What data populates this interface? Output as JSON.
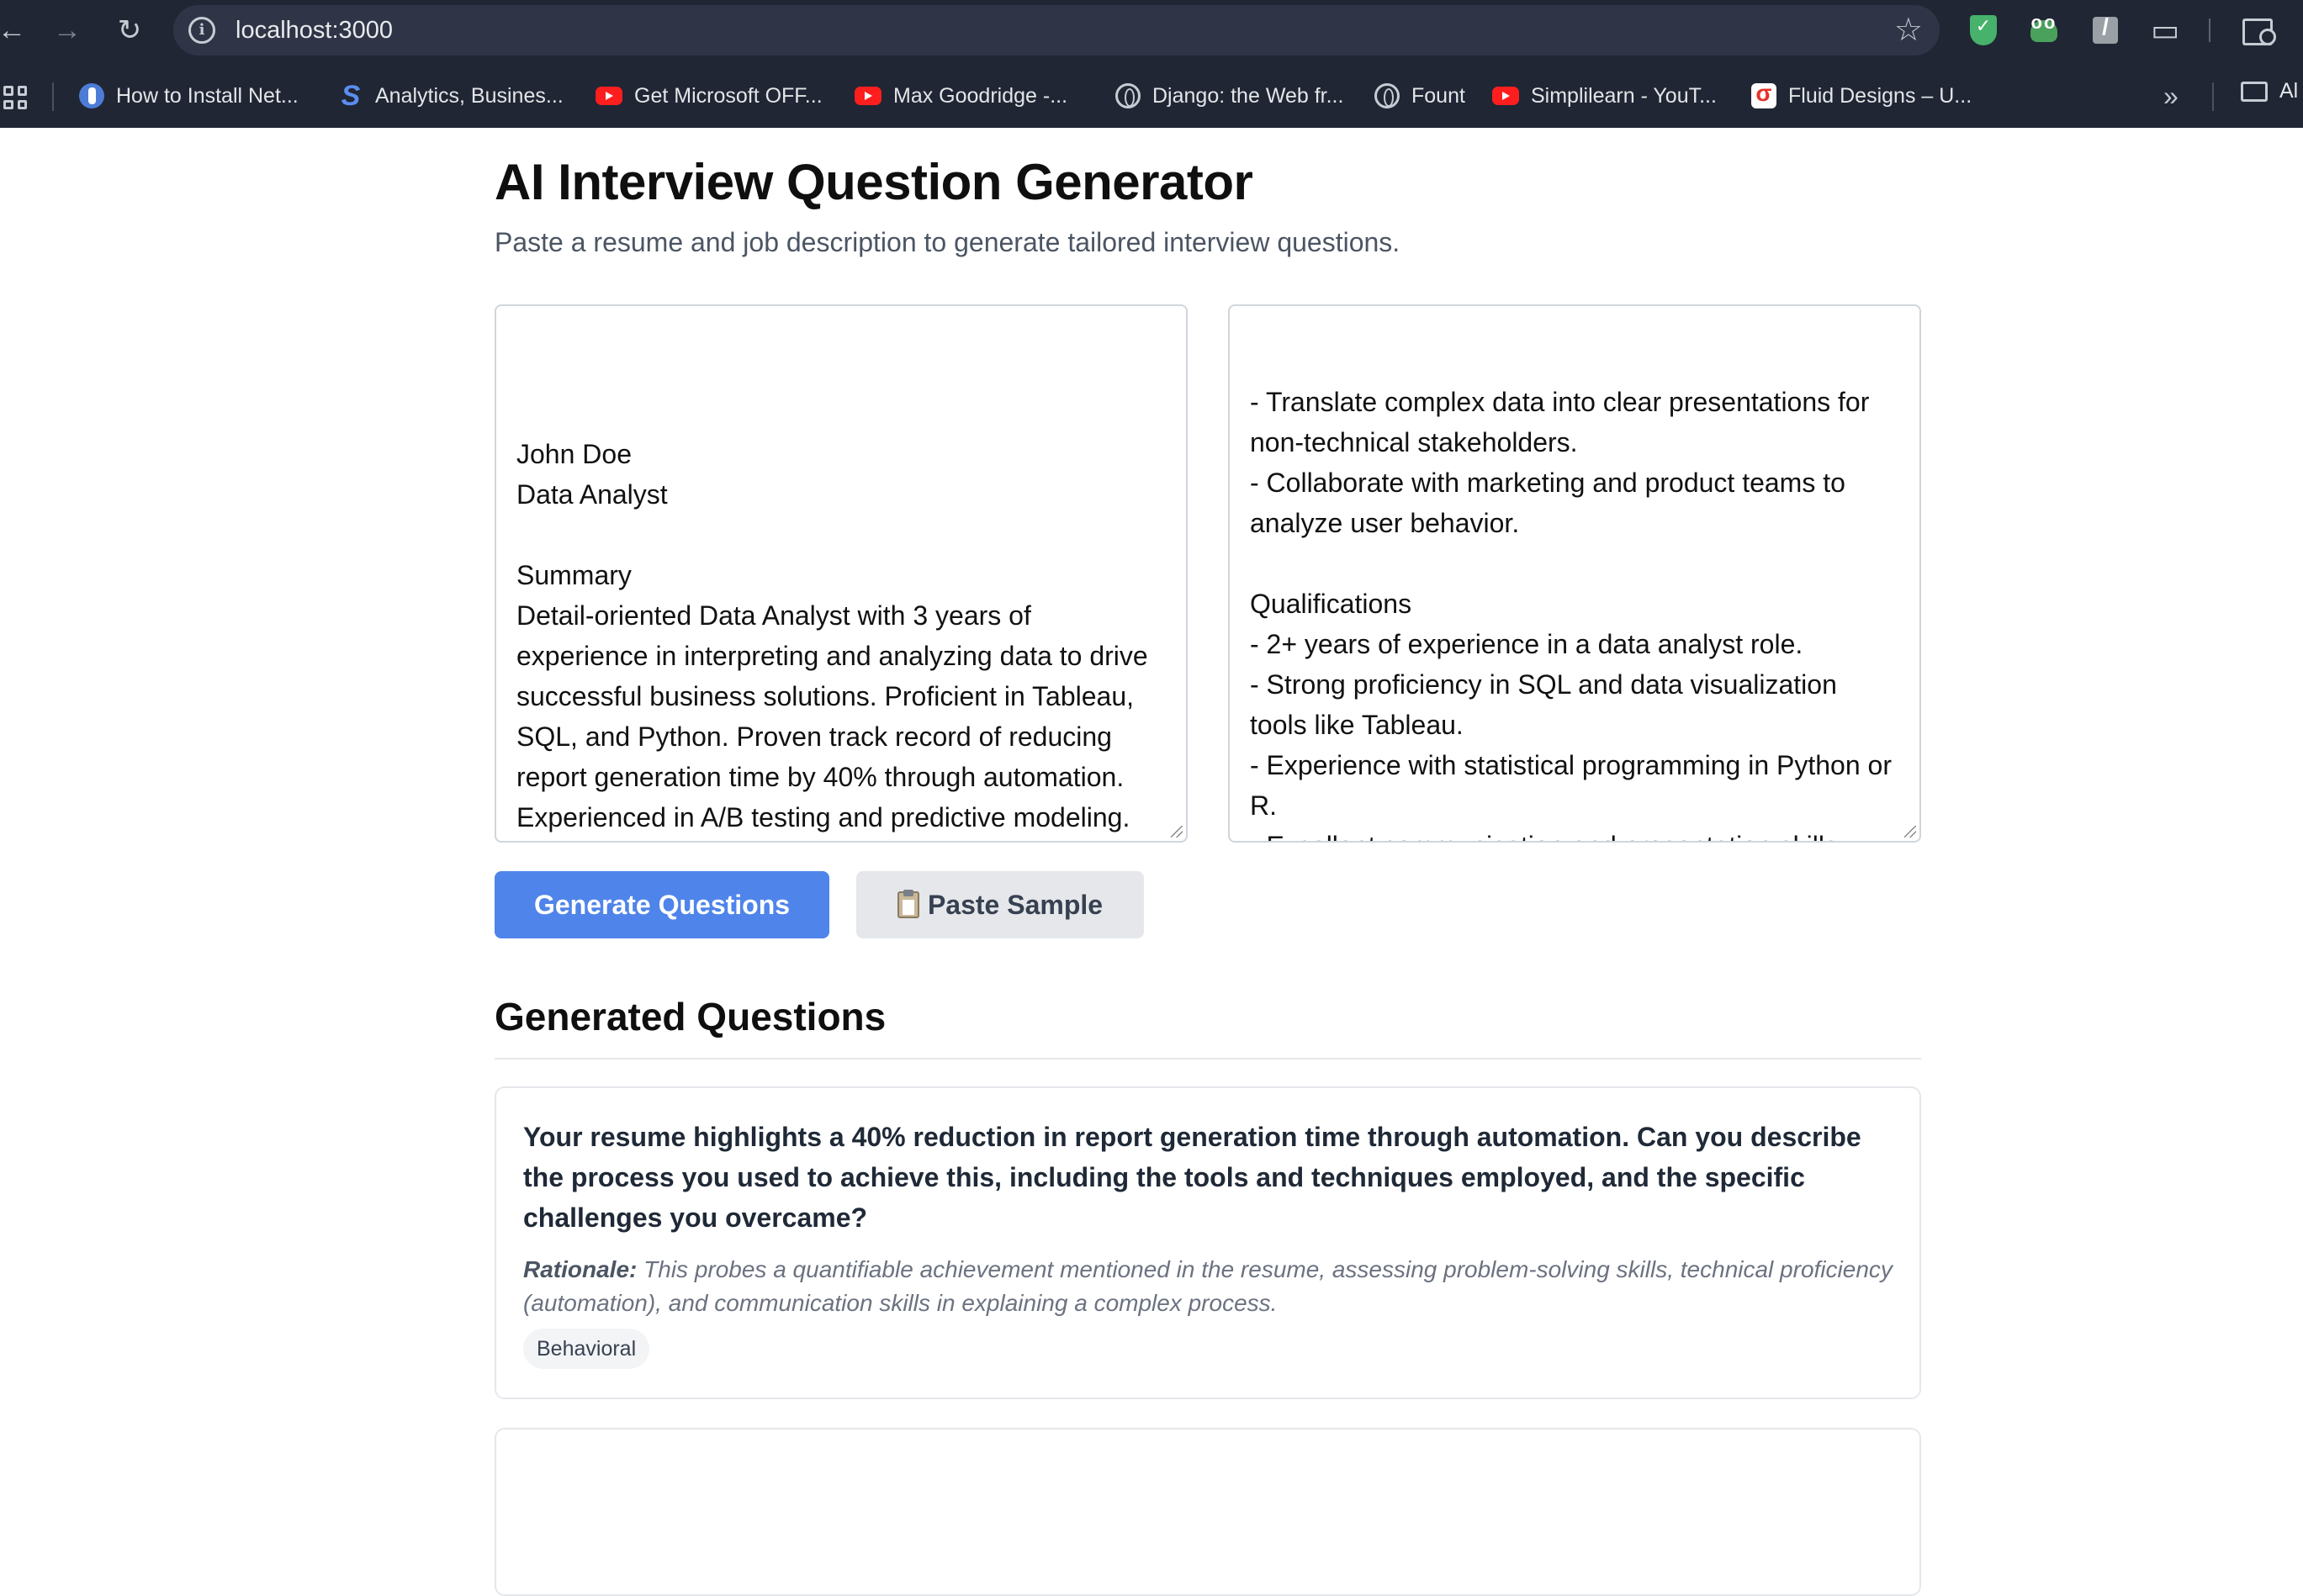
{
  "browser": {
    "url": "localhost:3000",
    "bookmarks": [
      {
        "label": "How to Install Net...",
        "icon": "dotnet-icon"
      },
      {
        "label": "Analytics, Busines...",
        "icon": "analytics-icon"
      },
      {
        "label": "Get Microsoft OFF...",
        "icon": "youtube-icon"
      },
      {
        "label": "Max Goodridge -...",
        "icon": "youtube-icon"
      },
      {
        "label": "Django: the Web fr...",
        "icon": "globe-icon"
      },
      {
        "label": "Fount",
        "icon": "globe-icon"
      },
      {
        "label": "Simplilearn - YouT...",
        "icon": "youtube-icon"
      },
      {
        "label": "Fluid Designs – U...",
        "icon": "fluid-icon"
      }
    ],
    "bookmark_folder": "Al"
  },
  "page": {
    "title": "AI Interview Question Generator",
    "subtitle": "Paste a resume and job description to generate tailored interview questions."
  },
  "resume_input": {
    "value": "John Doe\nData Analyst\n\nSummary\nDetail-oriented Data Analyst with 3 years of experience in interpreting and analyzing data to drive successful business solutions. Proficient in Tableau, SQL, and Python. Proven track record of reducing report generation time by 40% through automation. Experienced in A/B testing and predictive modeling.\n\nExperience"
  },
  "job_input": {
    "value": "- Translate complex data into clear presentations for non-technical stakeholders.\n- Collaborate with marketing and product teams to analyze user behavior.\n\nQualifications\n- 2+ years of experience in a data analyst role.\n- Strong proficiency in SQL and data visualization tools like Tableau.\n- Experience with statistical programming in Python or R.\n- Excellent communication and presentation skills."
  },
  "actions": {
    "generate_label": "Generate Questions",
    "paste_sample_label": "Paste Sample"
  },
  "results": {
    "heading": "Generated Questions",
    "questions": [
      {
        "question": "Your resume highlights a 40% reduction in report generation time through automation. Can you describe the process you used to achieve this, including the tools and techniques employed, and the specific challenges you overcame?",
        "rationale_label": "Rationale:",
        "rationale": "This probes a quantifiable achievement mentioned in the resume, assessing problem-solving skills, technical proficiency (automation), and communication skills in explaining a complex process.",
        "category": "Behavioral"
      }
    ]
  },
  "colors": {
    "chrome_bg": "#202634",
    "primary_button": "#4f84ea",
    "secondary_button": "#e5e7eb"
  }
}
